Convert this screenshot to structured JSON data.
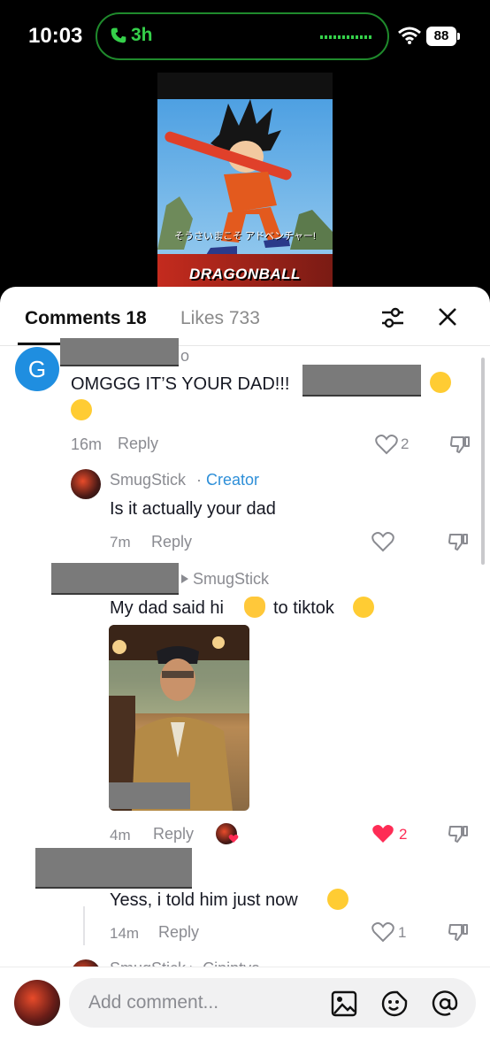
{
  "status": {
    "time": "10:03",
    "call_duration": "3h",
    "battery": "88"
  },
  "video": {
    "caption_jp": "そうさいまこそ アドベンチャー!",
    "title": "DRAGONBALL"
  },
  "tabs": {
    "comments": "Comments 18",
    "likes": "Likes 733"
  },
  "comments": [
    {
      "avatar_letter": "G",
      "name_suffix": "o",
      "text_line1": "OMGGG IT’S YOUR DAD!!!",
      "time": "16m",
      "reply": "Reply",
      "likes": "2"
    },
    {
      "name": "SmugStick",
      "creator_sep": "·",
      "creator": "Creator",
      "text": "Is it actually your dad",
      "time": "7m",
      "reply": "Reply"
    },
    {
      "reply_to": "SmugStick",
      "text": "My dad said hi",
      "text2": "to tiktok",
      "time": "4m",
      "reply": "Reply",
      "likes": "2"
    },
    {
      "text": "Yess, i told him just now",
      "time": "14m",
      "reply": "Reply",
      "likes": "1"
    }
  ],
  "partial_row": "SmugStick ▸ Ciniptya",
  "input": {
    "placeholder": "Add comment..."
  },
  "colors": {
    "creator": "#2e8fd8",
    "liked_heart": "#fe2c55",
    "call_green": "#35d04a"
  }
}
